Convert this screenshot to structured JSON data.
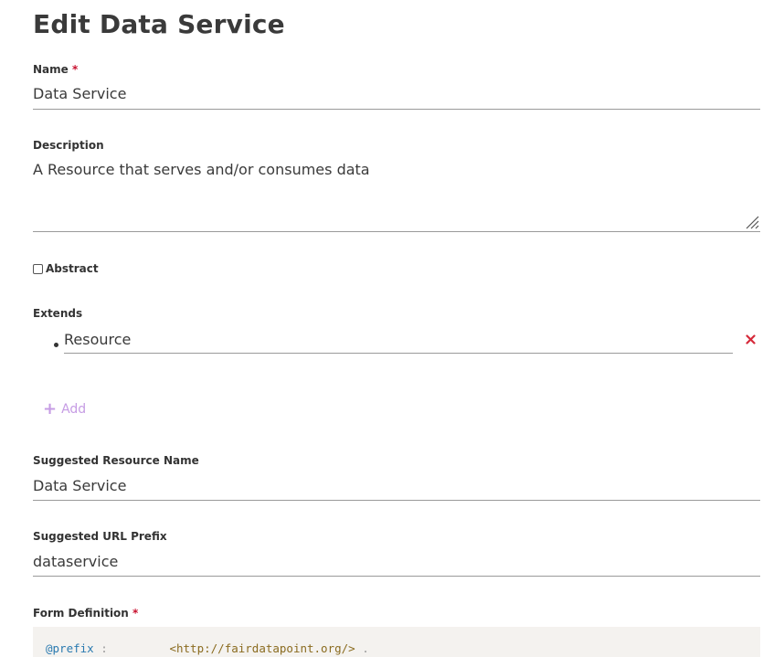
{
  "page": {
    "title": "Edit Data Service"
  },
  "name": {
    "label": "Name",
    "required_mark": "*",
    "value": "Data Service"
  },
  "description": {
    "label": "Description",
    "value": "A Resource that serves and/or consumes data"
  },
  "abstract": {
    "label": "Abstract",
    "checked": false
  },
  "extends": {
    "label": "Extends",
    "items": [
      {
        "value": "Resource",
        "remove_icon": "close-icon"
      }
    ],
    "add_label": "Add",
    "add_icon": "plus-icon"
  },
  "suggested_resource_name": {
    "label": "Suggested Resource Name",
    "value": "Data Service"
  },
  "suggested_url_prefix": {
    "label": "Suggested URL Prefix",
    "value": "dataservice"
  },
  "form_definition": {
    "label": "Form Definition",
    "required_mark": "*",
    "code_line_1": {
      "keyword": "@prefix",
      "colon": ":",
      "uri": "<http://fairdatapoint.org/>",
      "dot": "."
    }
  },
  "colors": {
    "required": "#c8102e",
    "remove": "#d62a3a",
    "add": "#c69ce4",
    "code_background": "#f4f2ef"
  }
}
